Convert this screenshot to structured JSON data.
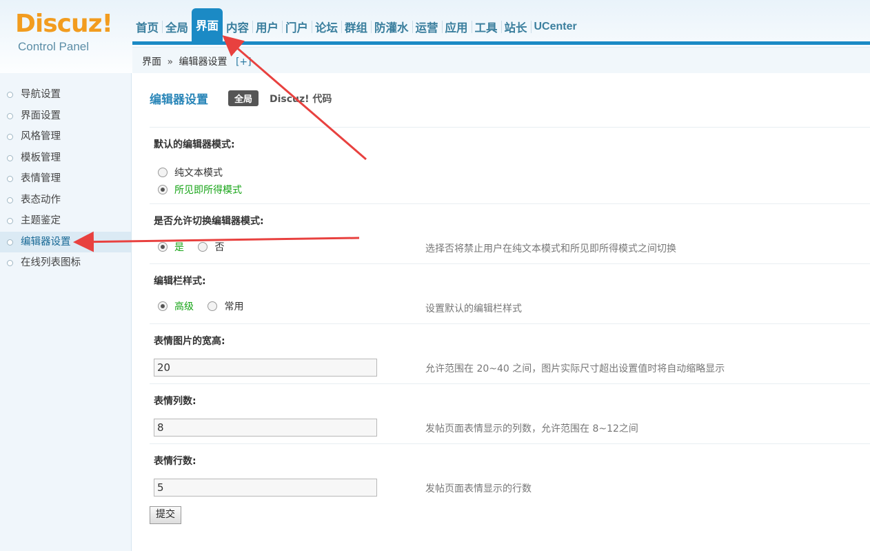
{
  "logo": {
    "brand": "Discuz!",
    "subtitle": "Control Panel"
  },
  "nav": {
    "items": [
      "首页",
      "全局",
      "界面",
      "内容",
      "用户",
      "门户",
      "论坛",
      "群组",
      "防灌水",
      "运营",
      "应用",
      "工具",
      "站长",
      "UCenter"
    ],
    "active": "界面"
  },
  "breadcrumb": {
    "section": "界面",
    "separator": "»",
    "page": "编辑器设置",
    "toggle": "[+]"
  },
  "sidebar": {
    "items": [
      {
        "label": "导航设置"
      },
      {
        "label": "界面设置"
      },
      {
        "label": "风格管理"
      },
      {
        "label": "模板管理"
      },
      {
        "label": "表情管理"
      },
      {
        "label": "表态动作"
      },
      {
        "label": "主题鉴定"
      },
      {
        "label": "编辑器设置",
        "active": true
      },
      {
        "label": "在线列表图标"
      }
    ]
  },
  "main": {
    "title": "编辑器设置",
    "tab_global": "全局",
    "tab_code": "Discuz! 代码",
    "sections": {
      "default_mode": {
        "label": "默认的编辑器模式:",
        "options": [
          "纯文本模式",
          "所见即所得模式"
        ],
        "selected": "所见即所得模式"
      },
      "allow_switch": {
        "label": "是否允许切换编辑器模式:",
        "options": [
          "是",
          "否"
        ],
        "selected": "是",
        "description": "选择否将禁止用户在纯文本模式和所见即所得模式之间切换"
      },
      "toolbar_style": {
        "label": "编辑栏样式:",
        "options": [
          "高级",
          "常用"
        ],
        "selected": "高级",
        "description": "设置默认的编辑栏样式"
      },
      "smiley_size": {
        "label": "表情图片的宽高:",
        "value": "20",
        "description": "允许范围在 20~40 之间，图片实际尺寸超出设置值时将自动缩略显示"
      },
      "smiley_cols": {
        "label": "表情列数:",
        "value": "8",
        "description": "发帖页面表情显示的列数，允许范围在 8~12之间"
      },
      "smiley_rows": {
        "label": "表情行数:",
        "value": "5",
        "description": "发帖页面表情显示的行数"
      }
    },
    "submit_label": "提交"
  },
  "colors": {
    "accent": "#1b8ac5",
    "arrow": "#e8413f",
    "selected_text": "#17a417"
  }
}
